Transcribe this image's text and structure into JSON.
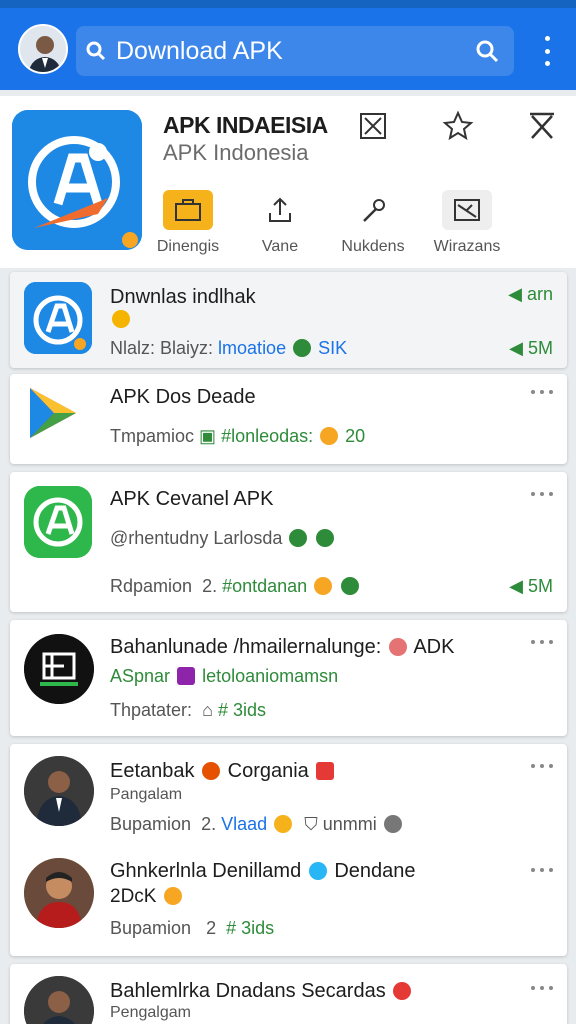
{
  "search": {
    "placeholder": "Download APK"
  },
  "app": {
    "title": "APK INDAEISIA",
    "subtitle": "APK Indonesia",
    "actions": [
      {
        "label": "Dinengis",
        "icon": "briefcase-icon"
      },
      {
        "label": "Vane",
        "icon": "share-icon"
      },
      {
        "label": "Nukdens",
        "icon": "wrench-icon"
      },
      {
        "label": "Wirazans",
        "icon": "image-icon"
      }
    ]
  },
  "list": [
    {
      "title": "Dnwnlas indlhak",
      "line1": "Nlalz: Blaiyz:",
      "line1_extra": "lmoatioe",
      "line1_tag": "SIK",
      "stat_top": "arn",
      "stat": "5M"
    },
    {
      "title": "APK Dos Deade",
      "line1": "Tmpamioc",
      "line1_extra": "#lonleodas:",
      "line1_num": "20"
    },
    {
      "title": "APK Cevanel APK",
      "line1": "@rhentudny Larlosda",
      "line2": "Rdpamion",
      "line2_num": "2.",
      "line2_extra": "#ontdanan",
      "stat": "5M"
    },
    {
      "title": "Bahanlunade /hmailernalunge:",
      "title_extra": "ADK",
      "line1": "ASpnar",
      "line1_extra": "letoloaniomamsn",
      "line2": "Thpatater:",
      "line2_extra": "# 3ids"
    },
    {
      "title": "Eetanbak",
      "title_extra": "Corgania",
      "line1": "Pangalam",
      "line2": "Bupamion",
      "line2_num": "2.",
      "line2_extra": "Vlaad",
      "line2_tail": "unmmi"
    },
    {
      "title": "Ghnkerlnla Denillamd",
      "title_extra": "Dendane",
      "line1": "2DcK",
      "line2": "Bupamion",
      "line2_num": "2",
      "line2_extra": "# 3ids"
    },
    {
      "title": "Bahlemlrka Dnadans Secardas",
      "line1": "Pengalgam"
    }
  ],
  "colors": {
    "topbar": "#1a73e8",
    "accent_green": "#2e8b3a",
    "app_icon_blue": "#1e88e5"
  }
}
